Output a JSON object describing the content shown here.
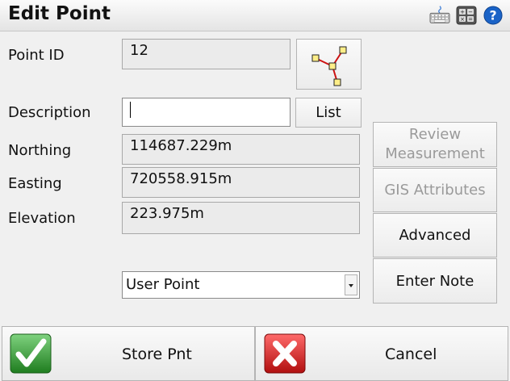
{
  "window": {
    "title": "Edit Point"
  },
  "titlebar_icons": [
    "keyboard-icon",
    "calculator-icon",
    "help-icon"
  ],
  "form": {
    "point_id": {
      "label": "Point ID",
      "value": "12"
    },
    "description": {
      "label": "Description",
      "value": ""
    },
    "northing": {
      "label": "Northing",
      "value": "114687.229m"
    },
    "easting": {
      "label": "Easting",
      "value": "720558.915m"
    },
    "elevation": {
      "label": "Elevation",
      "value": "223.975m"
    },
    "point_type": {
      "selected": "User Point"
    }
  },
  "buttons": {
    "list": "List",
    "review_line1": "Review",
    "review_line2": "Measurement",
    "gis": "GIS Attributes",
    "advanced": "Advanced",
    "enter_note": "Enter Note",
    "store": "Store Pnt",
    "cancel": "Cancel"
  },
  "colors": {
    "store_green": "#2e9b2e",
    "cancel_red": "#d42020",
    "disabled_text": "#9a9a9a"
  }
}
